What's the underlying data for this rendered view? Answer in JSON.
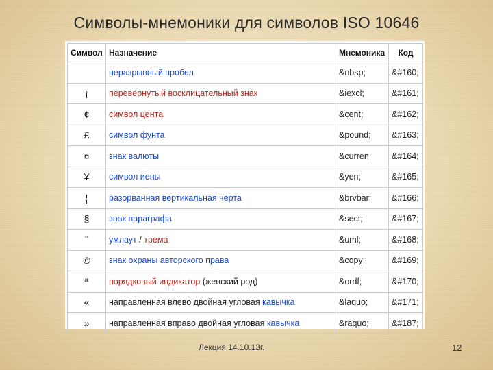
{
  "slide": {
    "title": "Символы-мнемоники для символов ISO 10646",
    "footer_text": "Лекция 14.10.13г.",
    "page_number": "12"
  },
  "table": {
    "headers": [
      "Символ",
      "Назначение",
      "Мнемоника",
      "Код"
    ],
    "rows": [
      {
        "symbol": "",
        "desc": [
          {
            "t": "неразрывный пробел",
            "c": "blue"
          }
        ],
        "mnemonic": "&nbsp;",
        "code": "&#160;"
      },
      {
        "symbol": "¡",
        "desc": [
          {
            "t": "перевёрнутый восклицательный знак",
            "c": "red"
          }
        ],
        "mnemonic": "&iexcl;",
        "code": "&#161;"
      },
      {
        "symbol": "¢",
        "desc": [
          {
            "t": "символ цента",
            "c": "red"
          }
        ],
        "mnemonic": "&cent;",
        "code": "&#162;"
      },
      {
        "symbol": "£",
        "desc": [
          {
            "t": "символ фунта",
            "c": "blue"
          }
        ],
        "mnemonic": "&pound;",
        "code": "&#163;"
      },
      {
        "symbol": "¤",
        "desc": [
          {
            "t": "знак валюты",
            "c": "blue"
          }
        ],
        "mnemonic": "&curren;",
        "code": "&#164;"
      },
      {
        "symbol": "¥",
        "desc": [
          {
            "t": "символ иены",
            "c": "blue"
          }
        ],
        "mnemonic": "&yen;",
        "code": "&#165;"
      },
      {
        "symbol": "¦",
        "desc": [
          {
            "t": "разорванная вертикальная черта",
            "c": "blue"
          }
        ],
        "mnemonic": "&brvbar;",
        "code": "&#166;"
      },
      {
        "symbol": "§",
        "desc": [
          {
            "t": "знак параграфа",
            "c": "blue"
          }
        ],
        "mnemonic": "&sect;",
        "code": "&#167;"
      },
      {
        "symbol": "¨",
        "desc": [
          {
            "t": "умлаут",
            "c": "blue"
          },
          {
            "t": " / ",
            "c": "dark"
          },
          {
            "t": "трема",
            "c": "red"
          }
        ],
        "mnemonic": "&uml;",
        "code": "&#168;"
      },
      {
        "symbol": "©",
        "desc": [
          {
            "t": "знак охраны авторского права",
            "c": "blue"
          }
        ],
        "mnemonic": "&copy;",
        "code": "&#169;"
      },
      {
        "symbol": "ª",
        "desc": [
          {
            "t": "порядковый индикатор",
            "c": "red"
          },
          {
            "t": " (женский род)",
            "c": "dark"
          }
        ],
        "mnemonic": "&ordf;",
        "code": "&#170;"
      },
      {
        "symbol": "«",
        "desc": [
          {
            "t": "направленная влево двойная угловая ",
            "c": "dark"
          },
          {
            "t": "кавычка",
            "c": "blue"
          }
        ],
        "mnemonic": "&laquo;",
        "code": "&#171;"
      },
      {
        "symbol": "»",
        "desc": [
          {
            "t": "направленная вправо двойная угловая ",
            "c": "dark"
          },
          {
            "t": "кавычка",
            "c": "blue"
          }
        ],
        "mnemonic": "&raquo;",
        "code": "&#187;"
      }
    ]
  },
  "colors": {
    "link_blue": "#1a49c9",
    "link_red": "#b3261e",
    "parchment": "#ead9b2"
  }
}
